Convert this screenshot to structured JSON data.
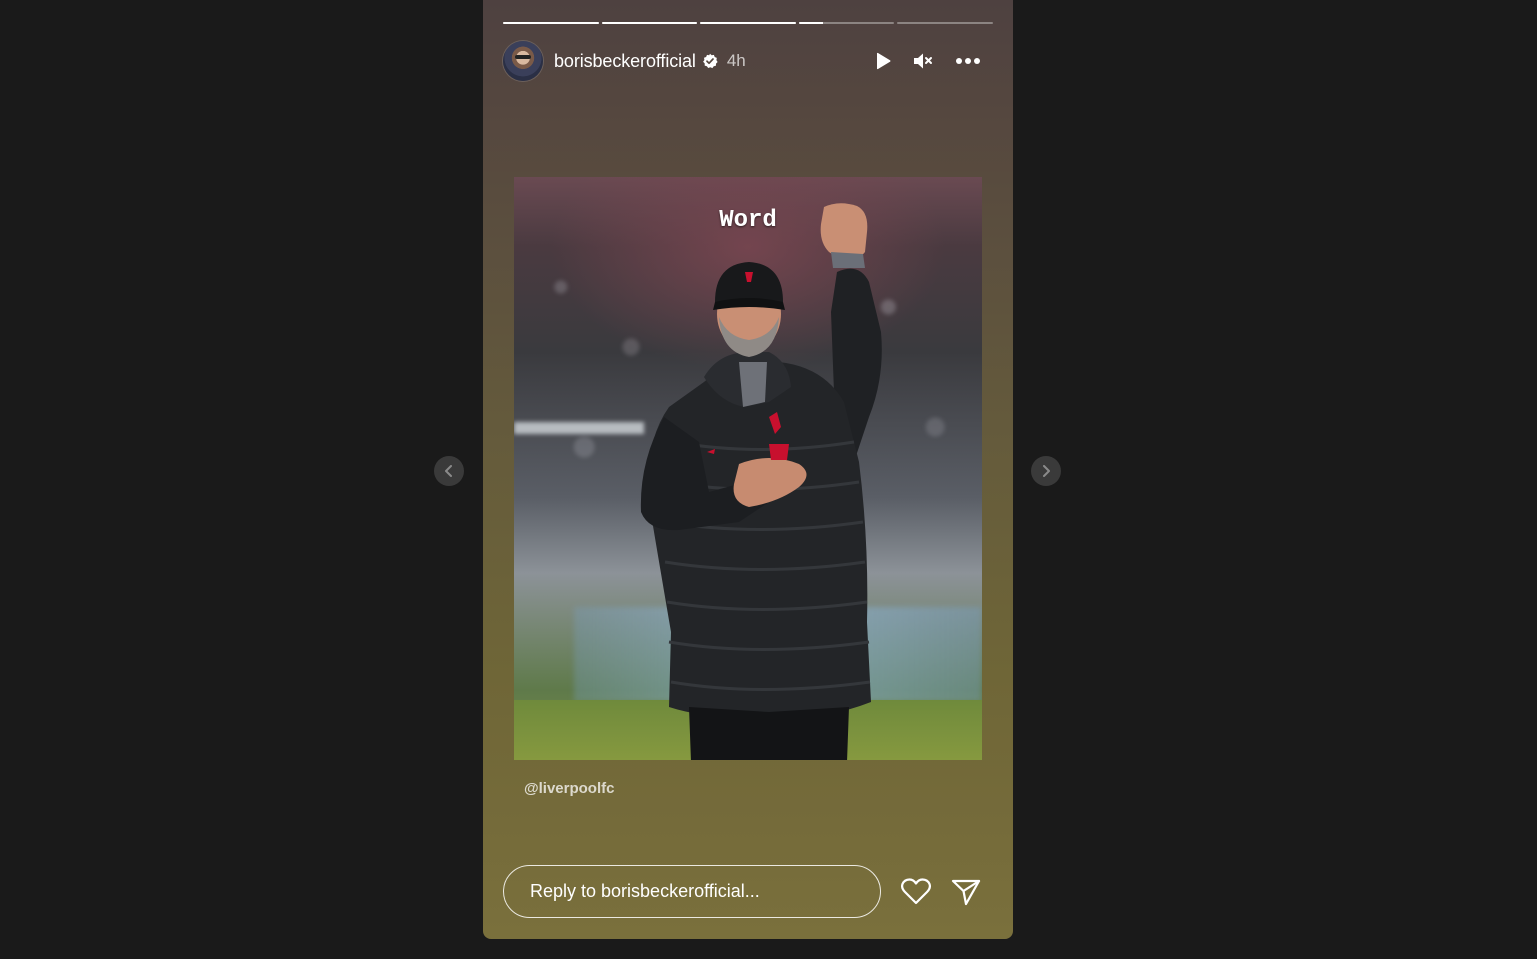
{
  "story": {
    "progress": [
      1,
      1,
      1,
      0.25,
      0,
      0
    ],
    "username": "borisbeckerofficial",
    "verified": true,
    "time_ago": "4h",
    "controls": {
      "play_icon": "play-icon",
      "mute_icon": "volume-muted-icon",
      "more_icon": "more-options-icon"
    },
    "image": {
      "overlay_text": "Word"
    },
    "mention": "@liverpoolfc",
    "reply": {
      "placeholder": "Reply to borisbeckerofficial..."
    },
    "footer_icons": {
      "like": "heart-icon",
      "share": "send-icon"
    }
  },
  "nav": {
    "prev_icon": "chevron-left-icon",
    "next_icon": "chevron-right-icon"
  },
  "colors": {
    "page_background": "#1a1a1a",
    "story_top": "#4e4140",
    "story_bottom": "#7a703c",
    "nav_button": "#3a3a3a"
  }
}
